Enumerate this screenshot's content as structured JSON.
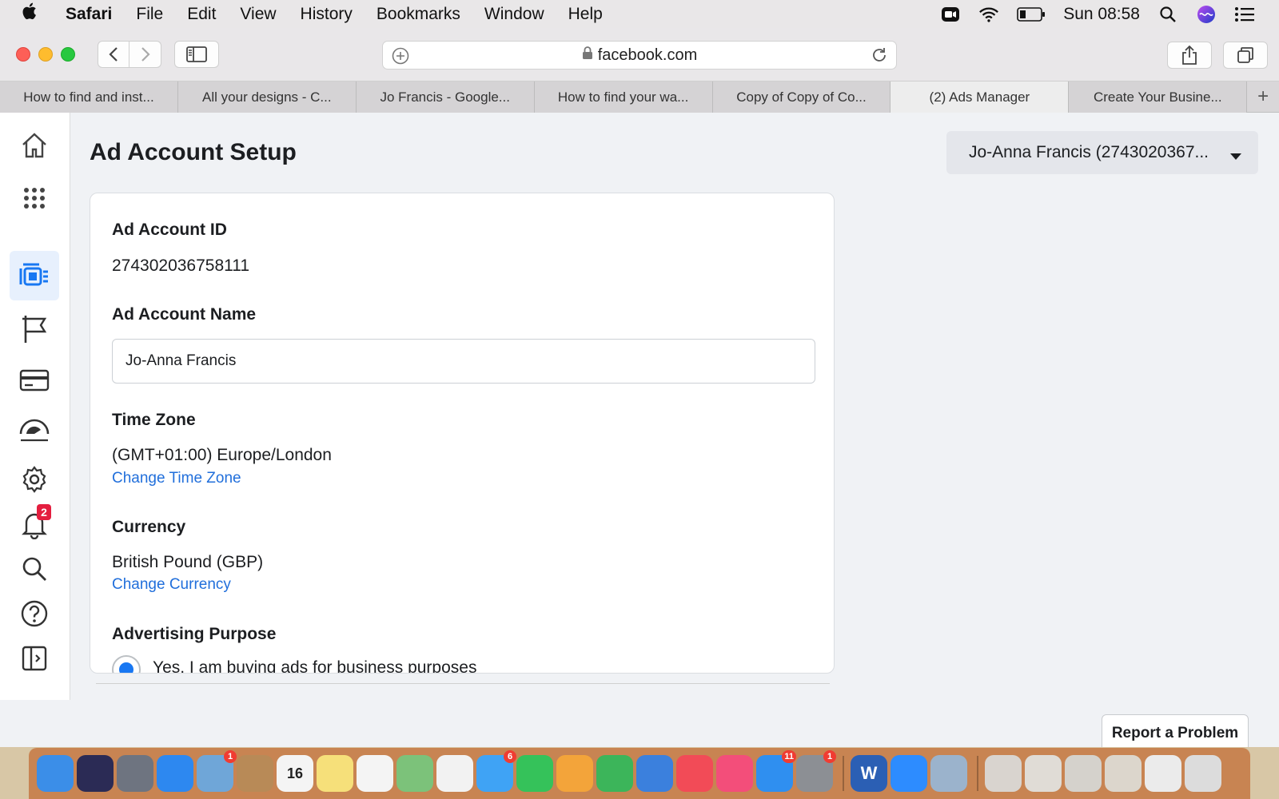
{
  "menubar": {
    "app_name": "Safari",
    "items": [
      "File",
      "Edit",
      "View",
      "History",
      "Bookmarks",
      "Window",
      "Help"
    ],
    "clock": "Sun 08:58",
    "status_icons": [
      "zoom-video-icon",
      "wifi-icon",
      "battery-icon",
      "spotlight-search-icon",
      "siri-icon",
      "control-center-icon"
    ]
  },
  "browser": {
    "url": "facebook.com",
    "tabs": [
      {
        "label": "How to find and inst..."
      },
      {
        "label": "All your designs - C..."
      },
      {
        "label": "Jo Francis - Google..."
      },
      {
        "label": "How to find your wa..."
      },
      {
        "label": "Copy of Copy of Co..."
      },
      {
        "label": "(2) Ads Manager",
        "active": true
      },
      {
        "label": "Create Your Busine..."
      }
    ],
    "new_tab_label": "+"
  },
  "sidebar": {
    "items": [
      {
        "icon": "home-icon"
      },
      {
        "icon": "apps-grid-icon"
      },
      {
        "icon": "ads-manager-icon",
        "active": true
      },
      {
        "icon": "flag-icon"
      },
      {
        "icon": "billing-card-icon"
      },
      {
        "icon": "events-manager-icon"
      },
      {
        "icon": "settings-gear-icon"
      },
      {
        "icon": "notifications-bell-icon",
        "badge": "2"
      },
      {
        "icon": "search-icon"
      },
      {
        "icon": "help-icon"
      },
      {
        "icon": "collapse-panel-icon"
      }
    ]
  },
  "page": {
    "title": "Ad Account Setup",
    "account_selector": "Jo-Anna Francis (2743020367..."
  },
  "form": {
    "account_id_label": "Ad Account ID",
    "account_id_value": "274302036758111",
    "account_name_label": "Ad Account Name",
    "account_name_value": "Jo-Anna Francis",
    "timezone_label": "Time Zone",
    "timezone_value": "(GMT+01:00) Europe/London",
    "timezone_link": "Change Time Zone",
    "currency_label": "Currency",
    "currency_value": "British Pound (GBP)",
    "currency_link": "Change Currency",
    "purpose_label": "Advertising Purpose",
    "purpose_option": "Yes, I am buying ads for business purposes"
  },
  "report_button": "Report a Problem",
  "dock": {
    "items": [
      {
        "name": "finder-icon",
        "color": "#3b8ee8",
        "glyph": ""
      },
      {
        "name": "siri-icon",
        "color": "#2b2b55",
        "glyph": ""
      },
      {
        "name": "launchpad-icon",
        "color": "#6e7480",
        "glyph": ""
      },
      {
        "name": "safari-icon",
        "color": "#2d88f0",
        "glyph": ""
      },
      {
        "name": "mail-icon",
        "color": "#6fa6d8",
        "glyph": "",
        "badge": "1"
      },
      {
        "name": "contacts-icon",
        "color": "#b88a57",
        "glyph": ""
      },
      {
        "name": "calendar-icon",
        "color": "#f4f4f4",
        "glyph": "16"
      },
      {
        "name": "notes-icon",
        "color": "#f6e07a",
        "glyph": ""
      },
      {
        "name": "reminders-icon",
        "color": "#f4f4f4",
        "glyph": ""
      },
      {
        "name": "maps-icon",
        "color": "#7cc27a",
        "glyph": ""
      },
      {
        "name": "photos-icon",
        "color": "#f2f2f2",
        "glyph": ""
      },
      {
        "name": "messages-icon",
        "color": "#3fa3f5",
        "glyph": "",
        "badge": "6"
      },
      {
        "name": "facetime-icon",
        "color": "#35c25a",
        "glyph": ""
      },
      {
        "name": "pages-icon",
        "color": "#f3a43a",
        "glyph": ""
      },
      {
        "name": "numbers-icon",
        "color": "#3cb55a",
        "glyph": ""
      },
      {
        "name": "keynote-icon",
        "color": "#3b80dd",
        "glyph": ""
      },
      {
        "name": "news-icon",
        "color": "#f24b57",
        "glyph": ""
      },
      {
        "name": "music-icon",
        "color": "#f34e7a",
        "glyph": ""
      },
      {
        "name": "app-store-icon",
        "color": "#2f8ff0",
        "glyph": "",
        "badge": "11"
      },
      {
        "name": "system-preferences-icon",
        "color": "#8c8f94",
        "glyph": "",
        "badge": "1"
      },
      {
        "name": "word-icon",
        "color": "#2b5fb4",
        "glyph": "W"
      },
      {
        "name": "zoom-icon",
        "color": "#2d8cff",
        "glyph": ""
      },
      {
        "name": "preview-icon",
        "color": "#9bb3cc",
        "glyph": ""
      },
      {
        "name": "screenshot-thumb-1-icon",
        "color": "#d9d4cf",
        "glyph": ""
      },
      {
        "name": "screenshot-thumb-2-icon",
        "color": "#e0dcd6",
        "glyph": ""
      },
      {
        "name": "screenshot-thumb-3-icon",
        "color": "#d5d2cc",
        "glyph": ""
      },
      {
        "name": "screenshot-thumb-4-icon",
        "color": "#dcd6cc",
        "glyph": ""
      },
      {
        "name": "screenshot-thumb-5-icon",
        "color": "#ebebeb",
        "glyph": ""
      },
      {
        "name": "trash-icon",
        "color": "#dcdcdc",
        "glyph": ""
      }
    ]
  },
  "colors": {
    "link_blue": "#216fdb",
    "active_nav_bg": "#e7f0fd",
    "radio_selected": "#1877f2",
    "badge_red": "#e41e3f"
  }
}
